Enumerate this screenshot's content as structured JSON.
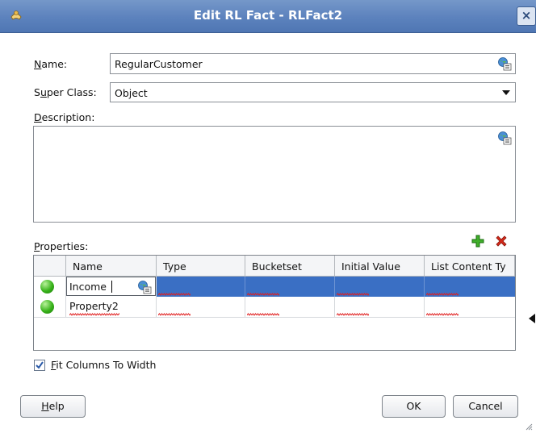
{
  "window": {
    "title": "Edit RL Fact - RLFact2",
    "close_label": "×"
  },
  "name": {
    "label_underline": "N",
    "label_rest": "ame:",
    "value": "RegularCustomer"
  },
  "super_class": {
    "label_pre": "S",
    "label_underline": "u",
    "label_rest": "per Class:",
    "value": "Object"
  },
  "description": {
    "label_underline": "D",
    "label_rest": "escription:",
    "value": ""
  },
  "properties": {
    "label_underline": "P",
    "label_rest": "roperties:",
    "columns": [
      "Name",
      "Type",
      "Bucketset",
      "Initial Value",
      "List Content Ty"
    ],
    "rows": [
      {
        "name": "Income",
        "type": "",
        "bucketset": "",
        "initial_value": "",
        "list_content": "",
        "selected": true
      },
      {
        "name": "Property2",
        "type": "",
        "bucketset": "",
        "initial_value": "",
        "list_content": "",
        "selected": false
      }
    ],
    "add_icon": "plus-icon",
    "delete_icon": "delete-x-icon"
  },
  "fit_columns": {
    "checked": true,
    "label_underline": "F",
    "label_rest": "it Columns To Width"
  },
  "buttons": {
    "help_underline": "H",
    "help_rest": "elp",
    "ok": "OK",
    "cancel": "Cancel"
  },
  "colors": {
    "titlebar": "#5c82bd",
    "selected_row": "#3a6fc4",
    "add": "#3fae2a",
    "delete": "#d42a1a"
  }
}
